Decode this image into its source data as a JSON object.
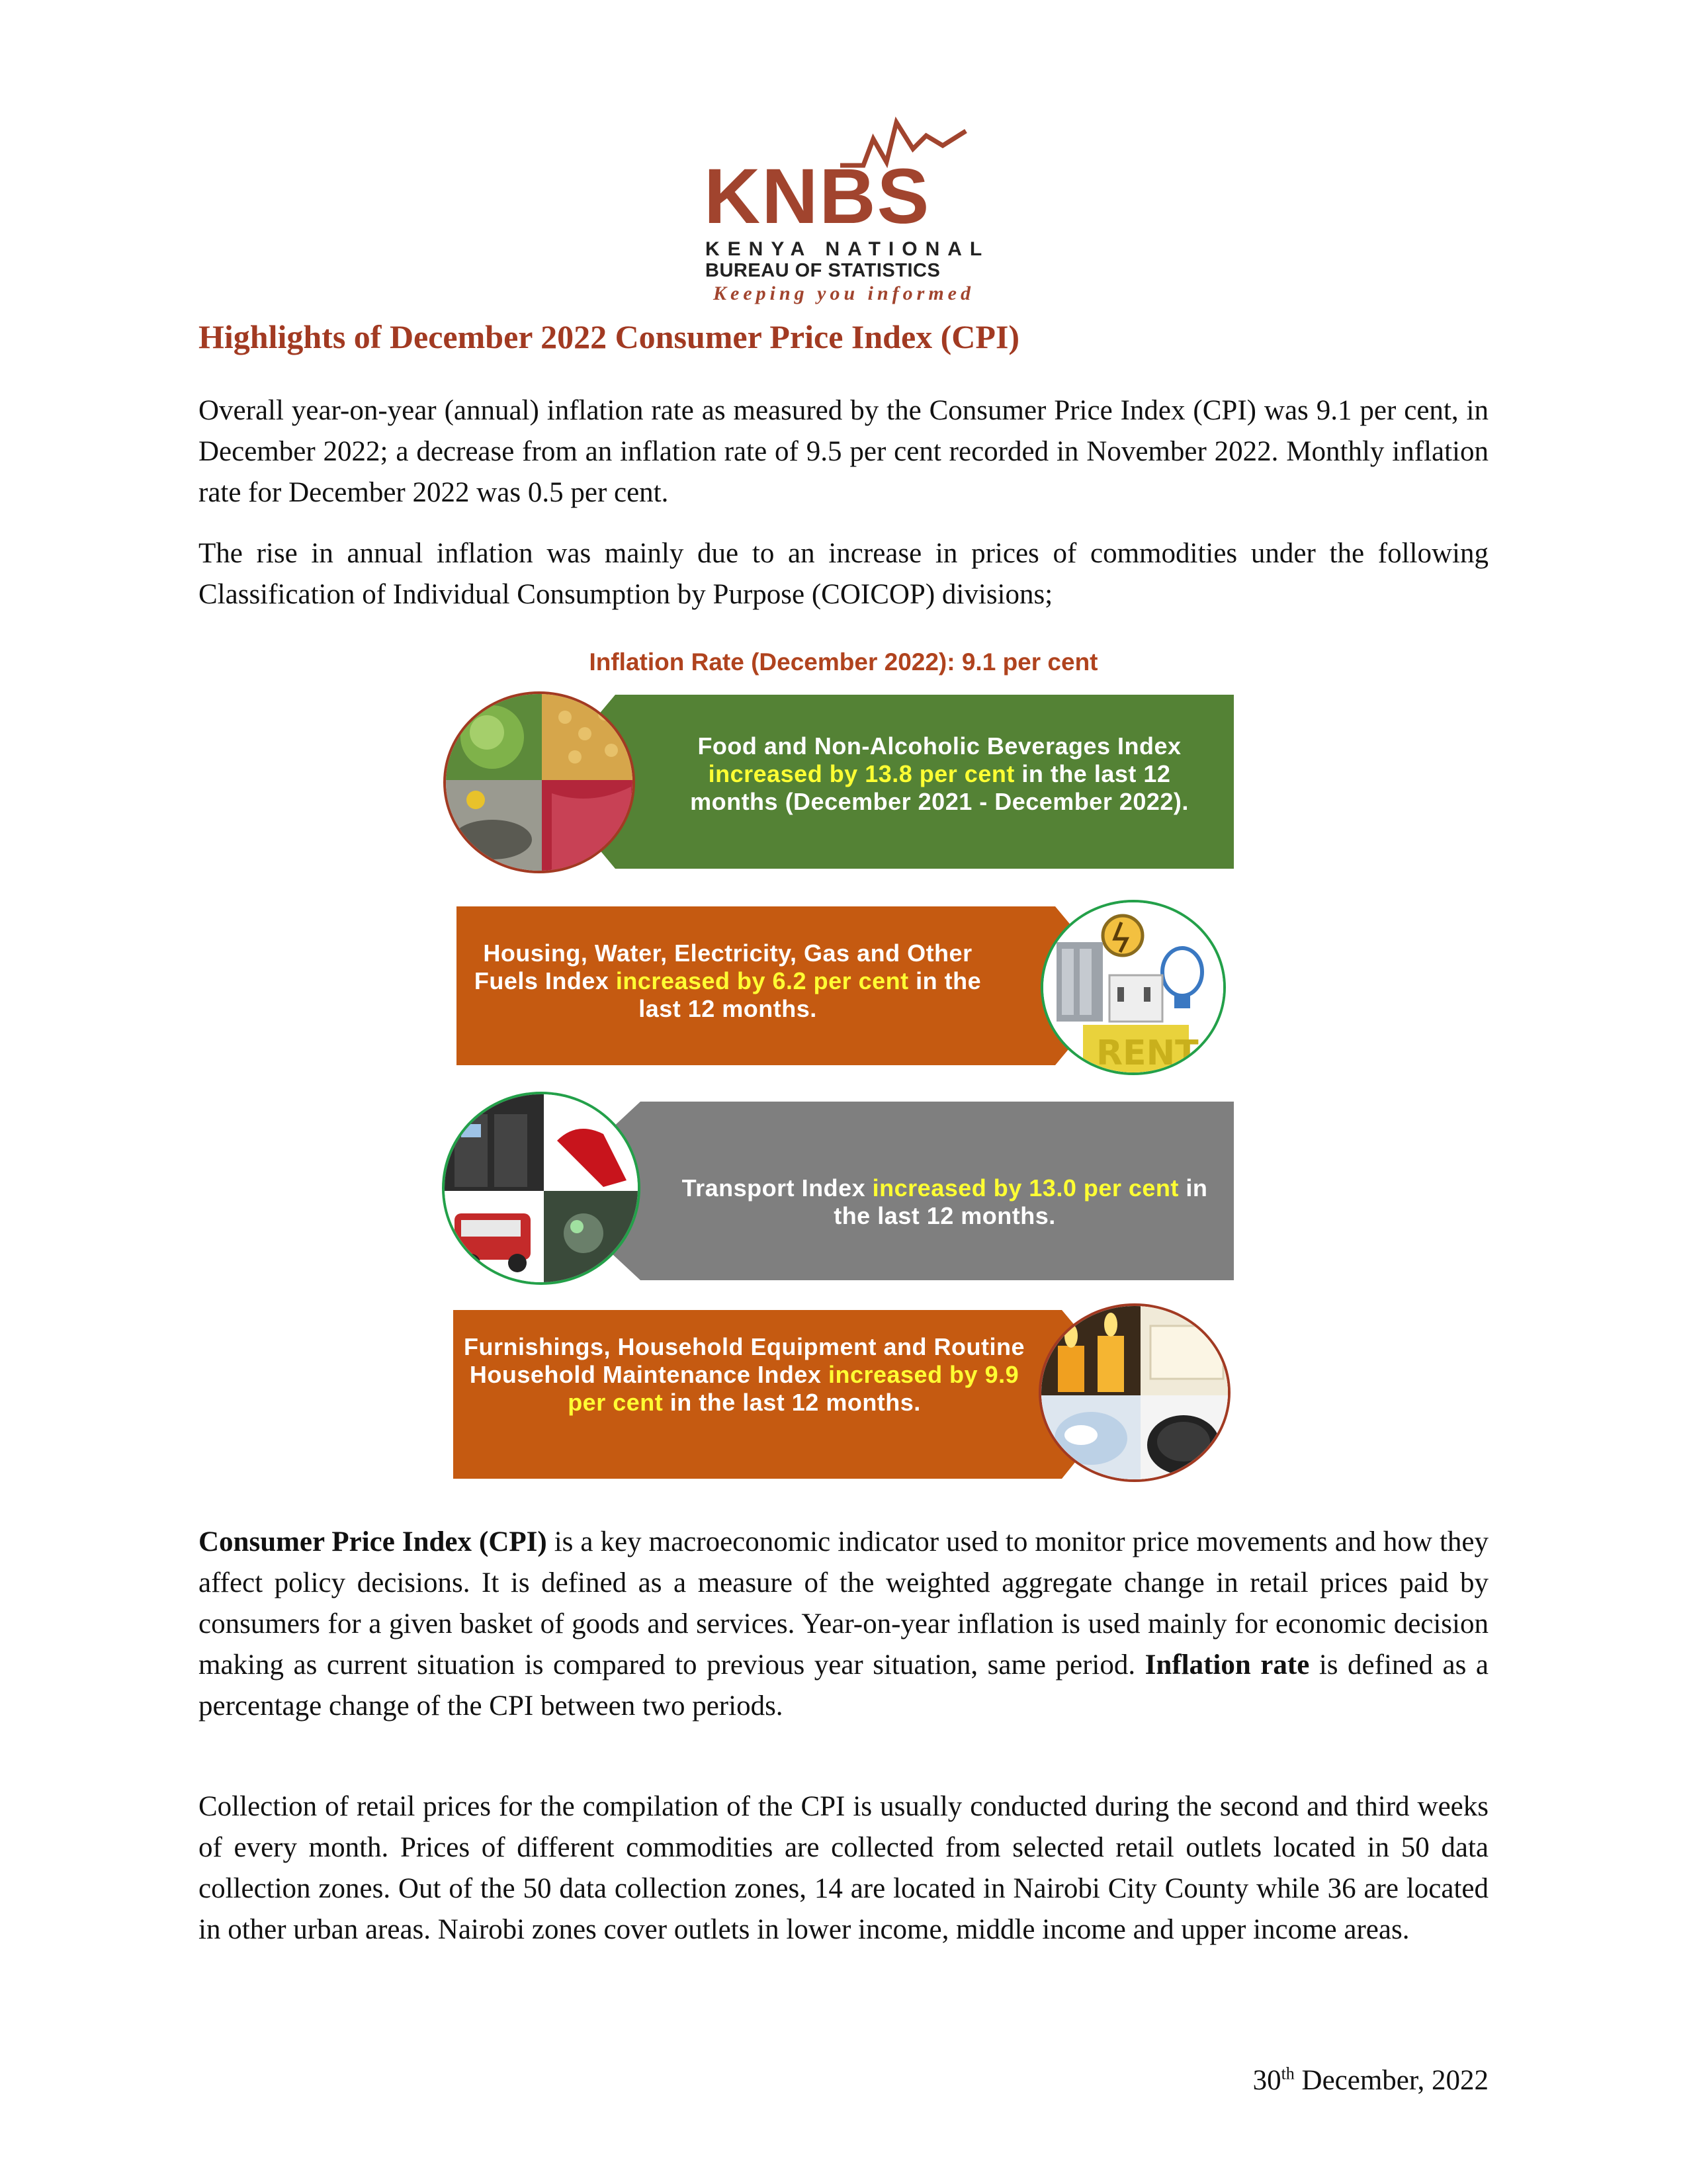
{
  "logo": {
    "main": "KNBS",
    "line1": "KENYA NATIONAL",
    "line2": "BUREAU OF STATISTICS",
    "tagline": "Keeping you informed",
    "color": "#a1442e"
  },
  "title": "Highlights of December 2022 Consumer Price Index (CPI)",
  "intro": {
    "p1": "Overall year-on-year (annual) inflation rate as measured by the Consumer Price Index (CPI) was 9.1 per cent, in December 2022; a decrease from an inflation rate of 9.5 per cent recorded in November 2022. Monthly inflation rate for December 2022 was 0.5 per cent.",
    "p2": "The rise in annual inflation was mainly due to an increase in prices of commodities under the following Classification of Individual Consumption by Purpose (COICOP) divisions;"
  },
  "infographic": {
    "title": "Inflation Rate (December 2022): 9.1 per cent",
    "colors": {
      "green": "#548235",
      "orange": "#c55a11",
      "grey": "#7f7f7f",
      "highlight": "#ffff33"
    },
    "items": [
      {
        "pre": "Food and Non-Alcoholic Beverages Index ",
        "highlight": "increased by 13.8 per cent",
        "post": " in the last 12 months (December 2021 - December 2022).",
        "icon": "food-collage-icon"
      },
      {
        "pre": "Housing, Water, Electricity, Gas and Other Fuels Index ",
        "highlight": "increased by 6.2 per cent",
        "post": " in the last 12 months.",
        "icon": "housing-utilities-collage-icon"
      },
      {
        "pre": "Transport Index ",
        "highlight": "increased by 13.0 per cent",
        "post": " in the last 12 months.",
        "icon": "transport-collage-icon"
      },
      {
        "pre": "Furnishings, Household Equipment and Routine Household Maintenance Index ",
        "highlight": "increased by 9.9 per cent",
        "post": " in the last 12 months.",
        "icon": "household-items-collage-icon"
      }
    ]
  },
  "cpi_def": {
    "term": "Consumer Price Index (CPI)",
    "text1": " is a key macroeconomic indicator used to monitor price movements and how they affect policy decisions. It is defined as a measure of the weighted aggregate change in retail prices paid by consumers for a given basket of goods and services. Year-on-year inflation is used mainly for economic decision making as current situation is compared to previous year situation, same period. ",
    "term2": "Inflation rate",
    "text2": " is defined as a percentage change of the CPI between two periods."
  },
  "collection": "Collection of retail prices for the compilation of the CPI is usually conducted during the second and third weeks of every month. Prices of different commodities are collected from selected retail outlets located in 50 data collection zones. Out of the 50 data collection zones, 14 are located in Nairobi City County while 36 are located in other urban areas. Nairobi zones cover outlets in lower income, middle income and upper income areas.",
  "footer": {
    "day": "30",
    "suffix": "th",
    "rest": " December, 2022"
  }
}
